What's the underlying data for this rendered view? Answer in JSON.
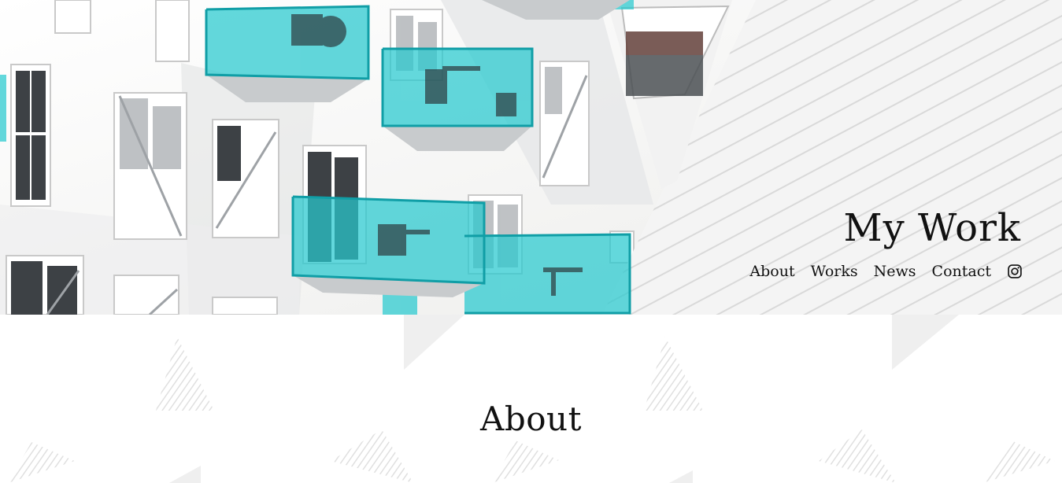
{
  "header": {
    "site_title": "My Work",
    "nav": [
      {
        "label": "About"
      },
      {
        "label": "Works"
      },
      {
        "label": "News"
      },
      {
        "label": "Contact"
      }
    ],
    "social_icon": "instagram-icon"
  },
  "hero": {
    "image_description_icon": "building-balconies-photo",
    "accent_color": "#27c9cf"
  },
  "about": {
    "heading": "About"
  }
}
